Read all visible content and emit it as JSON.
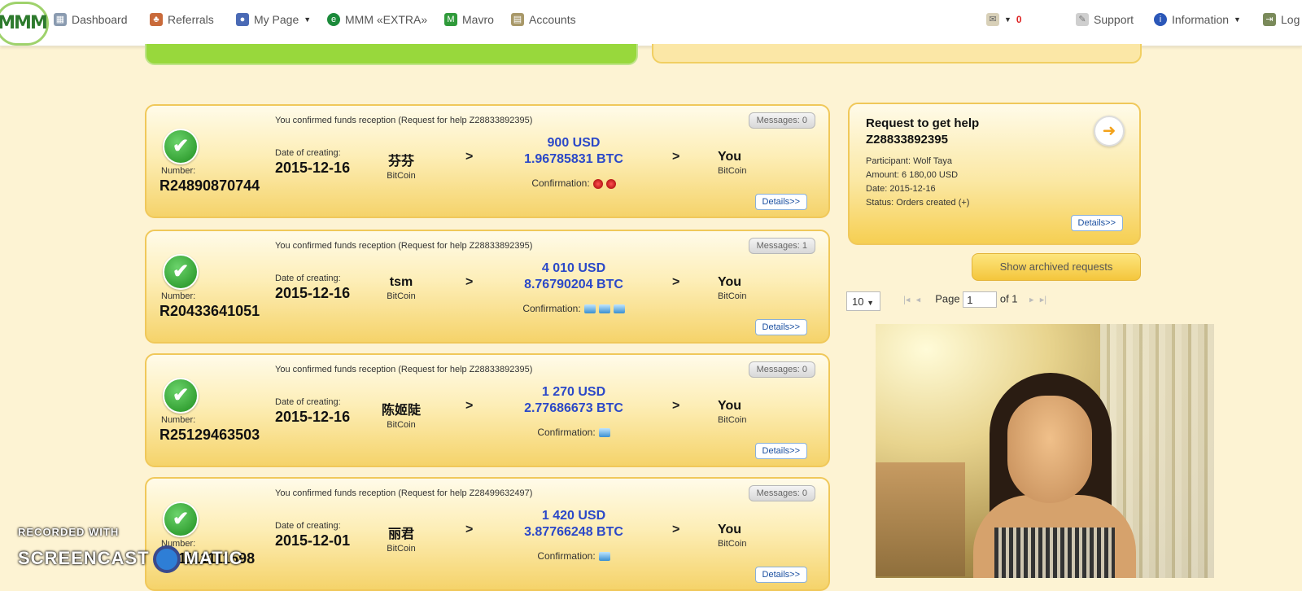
{
  "nav": {
    "logo": "MMM",
    "items": [
      {
        "label": "Dashboard",
        "icon": "dashboard-icon"
      },
      {
        "label": "Referrals",
        "icon": "referrals-icon"
      },
      {
        "label": "My Page",
        "icon": "user-icon"
      },
      {
        "label": "MMM «EXTRA»",
        "icon": "extra-icon"
      },
      {
        "label": "Mavro",
        "icon": "mavro-icon"
      },
      {
        "label": "Accounts",
        "icon": "accounts-icon"
      }
    ],
    "mail_count": "0",
    "support": "Support",
    "information": "Information",
    "logout": "Log"
  },
  "orders": [
    {
      "confirmed_text": "You confirmed funds reception (Request for help Z28833892395)",
      "messages": "Messages: 0",
      "number_label": "Number:",
      "number": "R24890870744",
      "date_label": "Date of creating:",
      "date": "2015-12-16",
      "payer": "芬芬",
      "payer_method": "BitCoin",
      "usd": "900 USD",
      "btc": "1.96785831 BTC",
      "confirmation_label": "Confirmation:",
      "you": "You",
      "you_method": "BitCoin",
      "details": "Details>>"
    },
    {
      "confirmed_text": "You confirmed funds reception (Request for help Z28833892395)",
      "messages": "Messages: 1",
      "number_label": "Number:",
      "number": "R20433641051",
      "date_label": "Date of creating:",
      "date": "2015-12-16",
      "payer": "tsm",
      "payer_method": "BitCoin",
      "usd": "4 010 USD",
      "btc": "8.76790204 BTC",
      "confirmation_label": "Confirmation:",
      "you": "You",
      "you_method": "BitCoin",
      "details": "Details>>"
    },
    {
      "confirmed_text": "You confirmed funds reception (Request for help Z28833892395)",
      "messages": "Messages: 0",
      "number_label": "Number:",
      "number": "R25129463503",
      "date_label": "Date of creating:",
      "date": "2015-12-16",
      "payer": "陈姬陡",
      "payer_method": "BitCoin",
      "usd": "1 270 USD",
      "btc": "2.77686673 BTC",
      "confirmation_label": "Confirmation:",
      "you": "You",
      "you_method": "BitCoin",
      "details": "Details>>"
    },
    {
      "confirmed_text": "You confirmed funds reception (Request for help Z28499632497)",
      "messages": "Messages: 0",
      "number_label": "Number:",
      "number": "R21111111598",
      "date_label": "Date of creating:",
      "date": "2015-12-01",
      "payer": "丽君",
      "payer_method": "BitCoin",
      "usd": "1 420 USD",
      "btc": "3.87766248 BTC",
      "confirmation_label": "Confirmation:",
      "you": "You",
      "you_method": "BitCoin",
      "details": "Details>>"
    }
  ],
  "help_request": {
    "title": "Request to get help",
    "id": "Z28833892395",
    "participant": "Participant: Wolf Taya",
    "amount": "Amount: 6 180,00 USD",
    "date": "Date: 2015-12-16",
    "status": "Status: Orders created (+)",
    "details": "Details>>"
  },
  "archived_button": "Show archived requests",
  "pagination": {
    "per_page": "10",
    "page_label": "Page",
    "page_value": "1",
    "of_label": "of 1"
  },
  "watermark": {
    "line1": "RECORDED WITH",
    "line2a": "SCREENCAST",
    "line2b": "MATIC"
  }
}
